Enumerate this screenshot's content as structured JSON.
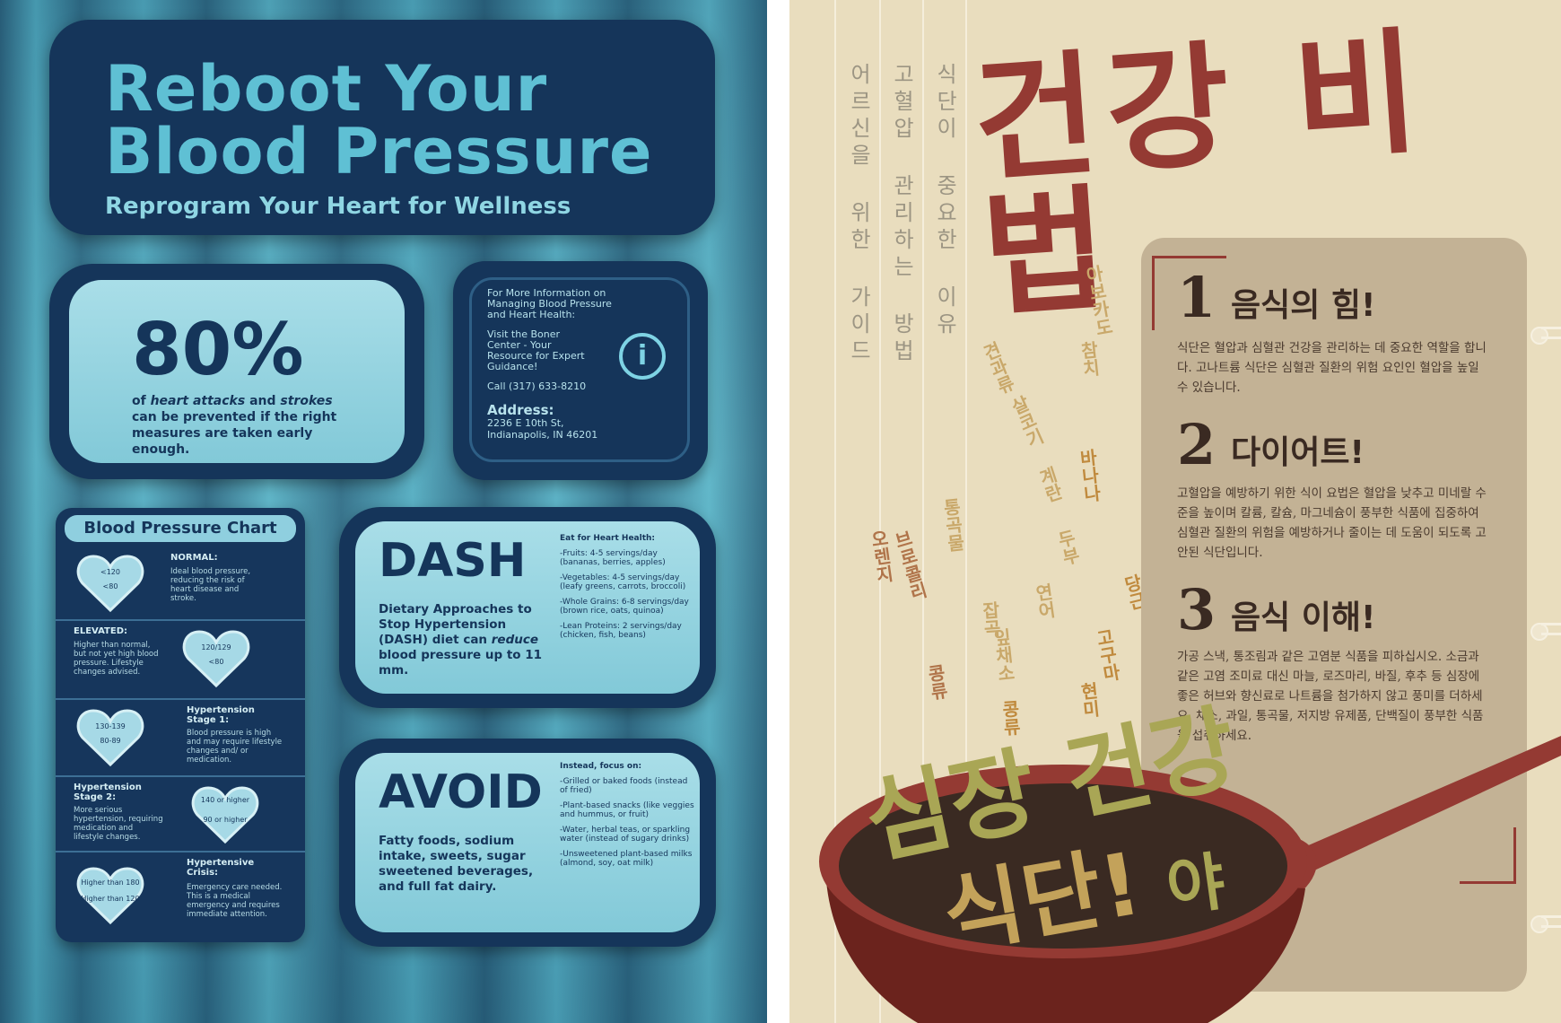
{
  "left_poster": {
    "title_line1": "Reboot Your",
    "title_line2": "Blood Pressure",
    "subtitle": "Reprogram Your Heart for Wellness",
    "stat": {
      "value": "80%",
      "text_prefix": "of ",
      "text_em1": "heart attacks",
      "text_mid": " and ",
      "text_em2": "strokes",
      "text_suffix": " can be prevented if the right measures are taken early enough."
    },
    "info": {
      "intro": "For More Information on Managing Blood Pressure and Heart Health:",
      "visit": "Visit the Boner Center - Your Resource for Expert Guidance!",
      "call": "Call (317) 633-8210",
      "address_label": "Address:",
      "address_line1": "2236 E 10th St,",
      "address_line2": "Indianapolis, IN 46201",
      "icon": "info-icon"
    },
    "chart": {
      "title": "Blood Pressure Chart",
      "rows": [
        {
          "title": "NORMAL:",
          "desc": "Ideal blood pressure, reducing the risk of heart disease and stroke.",
          "heart_top": "<120",
          "heart_bottom": "<80"
        },
        {
          "title": "ELEVATED:",
          "desc": "Higher than normal, but not yet high blood pressure. Lifestyle changes advised.",
          "heart_top": "120/129",
          "heart_bottom": "<80"
        },
        {
          "title": "Hypertension Stage 1:",
          "desc": "Blood pressure is high and may require lifestyle changes and/ or medication.",
          "heart_top": "130-139",
          "heart_bottom": "80-89"
        },
        {
          "title": "Hypertension Stage 2:",
          "desc": "More serious hypertension, requiring medication and lifestyle changes.",
          "heart_top": "140 or higher",
          "heart_bottom": "90 or higher"
        },
        {
          "title": "Hypertensive Crisis:",
          "desc": "Emergency care needed. This is a medical emergency and requires immediate attention.",
          "heart_top": "Higher than 180",
          "heart_bottom": "Higher than 120"
        }
      ]
    },
    "dash": {
      "title": "DASH",
      "desc_a": "Dietary Approaches to Stop Hypertension (DASH) diet can ",
      "desc_em": "reduce",
      "desc_b": " blood pressure up to 11 mm.",
      "list_head": "Eat for Heart Health:",
      "items": [
        "-Fruits: 4-5 servings/day (bananas, berries, apples)",
        "-Vegetables: 4-5 servings/day (leafy greens, carrots, broccoli)",
        "-Whole Grains: 6-8 servings/day (brown rice, oats, quinoa)",
        "-Lean Proteins: 2 servings/day (chicken, fish, beans)"
      ]
    },
    "avoid": {
      "title": "AVOID",
      "desc": "Fatty foods, sodium intake, sweets, sugar sweetened beverages, and full fat dairy.",
      "list_head": "Instead, focus on:",
      "items": [
        "-Grilled or baked foods (instead of fried)",
        "-Plant-based snacks (like veggies and hummus, or fruit)",
        "-Water, herbal teas, or sparkling water (instead of sugary drinks)",
        "-Unsweetened plant-based milks (almond, soy, oat milk)"
      ]
    }
  },
  "right_poster": {
    "vertical_cols": [
      "어르신을 위한 가이드",
      "고혈압 관리하는 방법",
      "식단이 중요한 이유"
    ],
    "title": "건강 비법",
    "scatter_words": [
      {
        "text": "아보카도",
        "color": "#c9a86a"
      },
      {
        "text": "참치",
        "color": "#c9a86a"
      },
      {
        "text": "견과류",
        "color": "#c9a86a"
      },
      {
        "text": "살코기",
        "color": "#c9a86a"
      },
      {
        "text": "계란",
        "color": "#c9a86a"
      },
      {
        "text": "두부",
        "color": "#c9a86a"
      },
      {
        "text": "연어",
        "color": "#c9a86a"
      },
      {
        "text": "바나나",
        "color": "#c08a3e"
      },
      {
        "text": "브로콜리",
        "color": "#b0744a"
      },
      {
        "text": "오렌지",
        "color": "#b0744a"
      },
      {
        "text": "통곡물",
        "color": "#c9a86a"
      },
      {
        "text": "잡곡",
        "color": "#c9a86a"
      },
      {
        "text": "잎채소",
        "color": "#c9a86a"
      },
      {
        "text": "콩류",
        "color": "#b0744a"
      },
      {
        "text": "콩류",
        "color": "#c08a3e"
      },
      {
        "text": "고구마",
        "color": "#c08a3e"
      },
      {
        "text": "당근",
        "color": "#c08a3e"
      },
      {
        "text": "현미",
        "color": "#c08a3e"
      }
    ],
    "sections": [
      {
        "num": "1",
        "title": "음식의 힘!",
        "body": "식단은 혈압과 심혈관 건강을 관리하는 데 중요한 역할을 합니다. 고나트륨 식단은 심혈관 질환의 위험 요인인 혈압을 높일 수 있습니다."
      },
      {
        "num": "2",
        "title": "다이어트!",
        "body": "고혈압을 예방하기 위한 식이 요법은 혈압을 낮추고 미네랄 수준을 높이며 칼륨, 칼슘, 마그네슘이 풍부한 식품에 집중하여 심혈관 질환의 위험을 예방하거나 줄이는 데 도움이 되도록 고안된 식단입니다."
      },
      {
        "num": "3",
        "title": "음식 이해!",
        "body": "가공 스낵, 통조림과 같은 고염분 식품을 피하십시오. 소금과 같은 고염 조미료 대신 마늘, 로즈마리, 바질, 후추 등 심장에 좋은 허브와 향신료로 나트륨을 첨가하지 않고 풍미를 더하세요. 채소, 과일, 통곡물, 저지방 유제품, 단백질이 풍부한 식품을 섭취하세요."
      }
    ],
    "bowl_line1": "심장 건강",
    "bowl_line2": "식단!",
    "bowl_line2_extra": "야"
  }
}
